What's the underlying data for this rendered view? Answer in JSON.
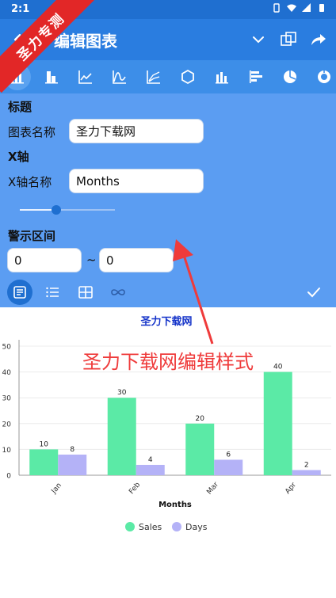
{
  "status": {
    "time": "2:1"
  },
  "appbar": {
    "title": "编辑图表"
  },
  "toolbar": {
    "chart_types": [
      "bar-chart-icon",
      "stacked-bar-icon",
      "line-chart-icon",
      "curve-chart-icon",
      "multi-line-icon",
      "radar-icon",
      "grouped-bar-icon",
      "horizontal-bar-icon",
      "pie-chart-icon",
      "donut-chart-icon"
    ],
    "selected": 0
  },
  "editor": {
    "title_section": "标题",
    "chart_name_label": "图表名称",
    "chart_name_value": "圣力下载网",
    "x_section": "X轴",
    "x_name_label": "X轴名称",
    "x_name_value": "Months",
    "slider_value": 0.38,
    "warn_section": "警示区间",
    "range_from": "0",
    "range_sep": "~",
    "range_to": "0"
  },
  "bottom_tabs": [
    "document-icon",
    "list-icon",
    "table-icon",
    "infinity-icon"
  ],
  "watermark": {
    "ribbon": "圣力专测",
    "caption": "圣力下载网编辑样式"
  },
  "colors": {
    "appbar": "#2a7de0",
    "panel": "#5b9df2",
    "sales": "#5beaa6",
    "days": "#b4b2f7",
    "title": "#1433c9"
  },
  "chart_data": {
    "type": "bar",
    "title": "圣力下载网",
    "xlabel": "Months",
    "ylabel": "",
    "categories": [
      "Jan",
      "Feb",
      "Mar",
      "Apr"
    ],
    "series": [
      {
        "name": "Sales",
        "values": [
          10,
          30,
          20,
          40
        ]
      },
      {
        "name": "Days",
        "values": [
          8,
          4,
          6,
          2
        ]
      }
    ],
    "ylim": [
      0,
      50
    ],
    "yticks": [
      0,
      10,
      20,
      30,
      40,
      50
    ],
    "grid": true,
    "legend": "bottom"
  }
}
